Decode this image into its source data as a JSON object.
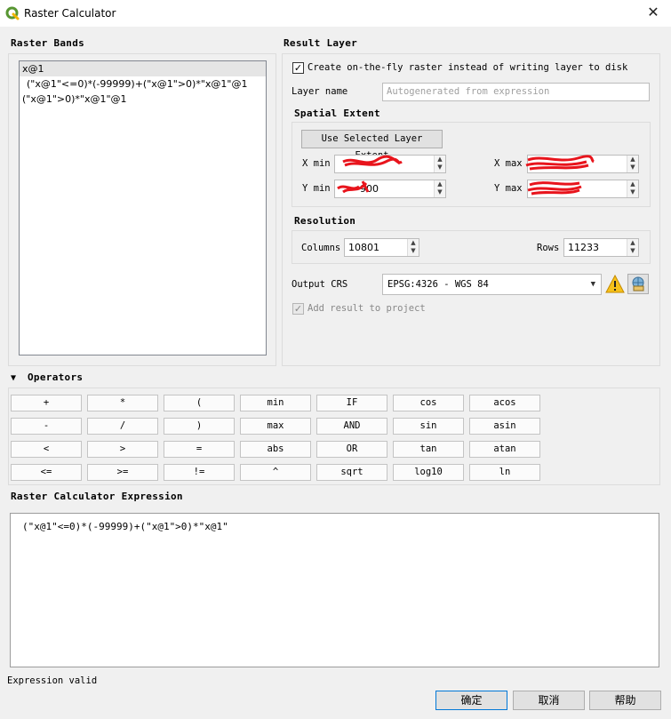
{
  "window": {
    "title": "Raster Calculator",
    "close_glyph": "✕"
  },
  "raster_bands": {
    "heading": "Raster Bands",
    "items": [
      "x@1",
      "(\"x@1\"<=0)*(-99999)+(\"x@1\">0)*\"x@1\"@1",
      "(\"x@1\">0)*\"x@1\"@1"
    ]
  },
  "result_layer": {
    "heading": "Result Layer",
    "create_on_the_fly_label": "Create on-the-fly raster instead of writing layer to disk",
    "create_on_the_fly_checked": true,
    "layer_name_label": "Layer name",
    "layer_name_placeholder": "Autogenerated from expression",
    "spatial_extent": {
      "heading": "Spatial Extent",
      "use_selected_button": "Use Selected Layer Extent",
      "xmin_label": "X min",
      "xmax_label": "X max",
      "ymin_label": "Y min",
      "ymax_label": "Y max",
      "ymin_visible": "900"
    },
    "resolution": {
      "heading": "Resolution",
      "columns_label": "Columns",
      "columns_value": "10801",
      "rows_label": "Rows",
      "rows_value": "11233"
    },
    "output_crs_label": "Output CRS",
    "output_crs_value": "EPSG:4326 - WGS 84",
    "add_result_label": "Add result to project",
    "add_result_checked": true
  },
  "operators": {
    "heading": "Operators",
    "rows": [
      [
        "+",
        "*",
        "(",
        "min",
        "IF",
        "cos",
        "acos"
      ],
      [
        "-",
        "/",
        ")",
        "max",
        "AND",
        "sin",
        "asin"
      ],
      [
        "<",
        ">",
        "=",
        "abs",
        "OR",
        "tan",
        "atan"
      ],
      [
        "<=",
        ">=",
        "!=",
        "^",
        "sqrt",
        "log10",
        "ln"
      ]
    ]
  },
  "expression": {
    "heading": "Raster Calculator Expression",
    "text": "(\"x@1\"<=0)*(-99999)+(\"x@1\">0)*\"x@1\""
  },
  "status_text": "Expression valid",
  "buttons": {
    "ok": "确定",
    "cancel": "取消",
    "help": "帮助"
  },
  "colors": {
    "qgis_green": "#589632",
    "redaction_red": "#e8141c",
    "warning_yellow": "#f6c11a",
    "default_button_border": "#0078d7"
  }
}
